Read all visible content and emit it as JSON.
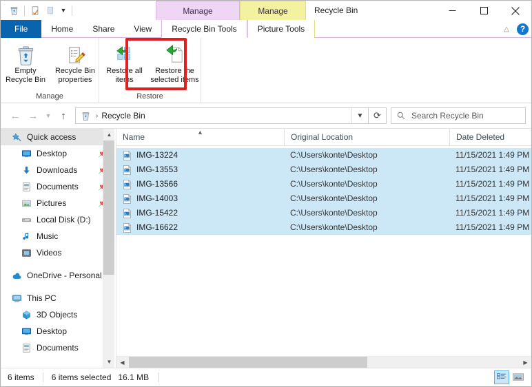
{
  "window": {
    "title": "Recycle Bin",
    "contextual_groups": [
      {
        "label": "Manage",
        "tab": "Recycle Bin Tools",
        "color": "#f0d6f5"
      },
      {
        "label": "Manage",
        "tab": "Picture Tools",
        "color": "#f4f2a0"
      }
    ],
    "controls": {
      "minimize": "minimize-icon",
      "maximize": "maximize-icon",
      "close": "close-icon"
    },
    "quick_access": [
      {
        "name": "recycle-bin-icon",
        "label": "Recycle Bin"
      },
      {
        "name": "properties-icon",
        "label": "Properties"
      },
      {
        "name": "paste-icon",
        "label": "Paste"
      },
      {
        "name": "customize-dropdown-icon",
        "label": "Customize Quick Access Toolbar"
      }
    ]
  },
  "tabs": [
    {
      "label": "File",
      "active": false,
      "kind": "file"
    },
    {
      "label": "Home",
      "active": false,
      "kind": "normal"
    },
    {
      "label": "Share",
      "active": false,
      "kind": "normal"
    },
    {
      "label": "View",
      "active": false,
      "kind": "normal"
    },
    {
      "label": "Recycle Bin Tools",
      "active": true,
      "kind": "contextual-recycle"
    },
    {
      "label": "Picture Tools",
      "active": false,
      "kind": "contextual-picture"
    }
  ],
  "ribbon": {
    "collapse_label": "Collapse the Ribbon",
    "help_label": "?",
    "groups": [
      {
        "label": "Manage",
        "buttons": [
          {
            "label": "Empty Recycle Bin",
            "icon": "empty-recycle-bin-icon",
            "highlighted": false
          },
          {
            "label": "Recycle Bin properties",
            "icon": "recycle-bin-properties-icon",
            "highlighted": false
          }
        ]
      },
      {
        "label": "Restore",
        "buttons": [
          {
            "label": "Restore all items",
            "icon": "restore-all-items-icon",
            "highlighted": false
          },
          {
            "label": "Restore the selected items",
            "icon": "restore-selected-items-icon",
            "highlighted": true
          }
        ]
      }
    ]
  },
  "addressbar": {
    "back": "back-arrow-icon",
    "forward": "forward-arrow-icon",
    "recent": "recent-locations-icon",
    "up": "up-arrow-icon",
    "crumb_icon": "recycle-bin-icon",
    "crumb_separator": "›",
    "path": "Recycle Bin",
    "dropdown": "address-dropdown-icon",
    "refresh": "refresh-icon"
  },
  "search": {
    "icon": "search-icon",
    "placeholder": "Search Recycle Bin",
    "value": ""
  },
  "sidebar": {
    "groups": [
      {
        "name": "quick-access",
        "root": {
          "label": "Quick access",
          "icon": "star-pin-icon",
          "selected": true
        },
        "items": [
          {
            "label": "Desktop",
            "icon": "desktop-icon",
            "pinned": true
          },
          {
            "label": "Downloads",
            "icon": "downloads-icon",
            "pinned": true
          },
          {
            "label": "Documents",
            "icon": "documents-icon",
            "pinned": true
          },
          {
            "label": "Pictures",
            "icon": "pictures-icon",
            "pinned": true
          },
          {
            "label": "Local Disk (D:)",
            "icon": "drive-icon",
            "pinned": false
          },
          {
            "label": "Music",
            "icon": "music-icon",
            "pinned": false
          },
          {
            "label": "Videos",
            "icon": "videos-icon",
            "pinned": false
          }
        ]
      },
      {
        "name": "onedrive",
        "root": {
          "label": "OneDrive - Personal",
          "icon": "onedrive-icon",
          "selected": false
        },
        "items": []
      },
      {
        "name": "this-pc",
        "root": {
          "label": "This PC",
          "icon": "this-pc-icon",
          "selected": false
        },
        "items": [
          {
            "label": "3D Objects",
            "icon": "3d-objects-icon",
            "pinned": false
          },
          {
            "label": "Desktop",
            "icon": "desktop-icon",
            "pinned": false
          },
          {
            "label": "Documents",
            "icon": "documents-icon",
            "pinned": false
          }
        ]
      }
    ],
    "pin_glyph": "➤"
  },
  "filelist": {
    "columns": [
      {
        "label": "Name",
        "sorted": true,
        "sort_dir": "asc"
      },
      {
        "label": "Original Location",
        "sorted": false,
        "sort_dir": ""
      },
      {
        "label": "Date Deleted",
        "sorted": false,
        "sort_dir": ""
      }
    ],
    "rows": [
      {
        "name": "IMG-13224",
        "location": "C:\\Users\\konte\\Desktop",
        "date": "11/15/2021 1:49 PM",
        "selected": true,
        "icon": "image-file-icon"
      },
      {
        "name": "IMG-13553",
        "location": "C:\\Users\\konte\\Desktop",
        "date": "11/15/2021 1:49 PM",
        "selected": true,
        "icon": "image-file-icon"
      },
      {
        "name": "IMG-13566",
        "location": "C:\\Users\\konte\\Desktop",
        "date": "11/15/2021 1:49 PM",
        "selected": true,
        "icon": "image-file-icon"
      },
      {
        "name": "IMG-14003",
        "location": "C:\\Users\\konte\\Desktop",
        "date": "11/15/2021 1:49 PM",
        "selected": true,
        "icon": "image-file-icon"
      },
      {
        "name": "IMG-15422",
        "location": "C:\\Users\\konte\\Desktop",
        "date": "11/15/2021 1:49 PM",
        "selected": true,
        "icon": "image-file-icon"
      },
      {
        "name": "IMG-16622",
        "location": "C:\\Users\\konte\\Desktop",
        "date": "11/15/2021 1:49 PM",
        "selected": true,
        "icon": "image-file-icon"
      }
    ]
  },
  "statusbar": {
    "item_count": "6 items",
    "selection": "6 items selected",
    "size": "16.1 MB",
    "views": [
      {
        "name": "details-view-button",
        "icon": "details-view-icon",
        "active": true
      },
      {
        "name": "large-icons-view-button",
        "icon": "large-icons-view-icon",
        "active": false
      }
    ]
  },
  "colors": {
    "accent": "#0a63ad",
    "selection": "#cce8f7",
    "highlight_box": "#e02020",
    "recycle_tab": "#f0d6f5",
    "picture_tab": "#f4f2a0"
  }
}
